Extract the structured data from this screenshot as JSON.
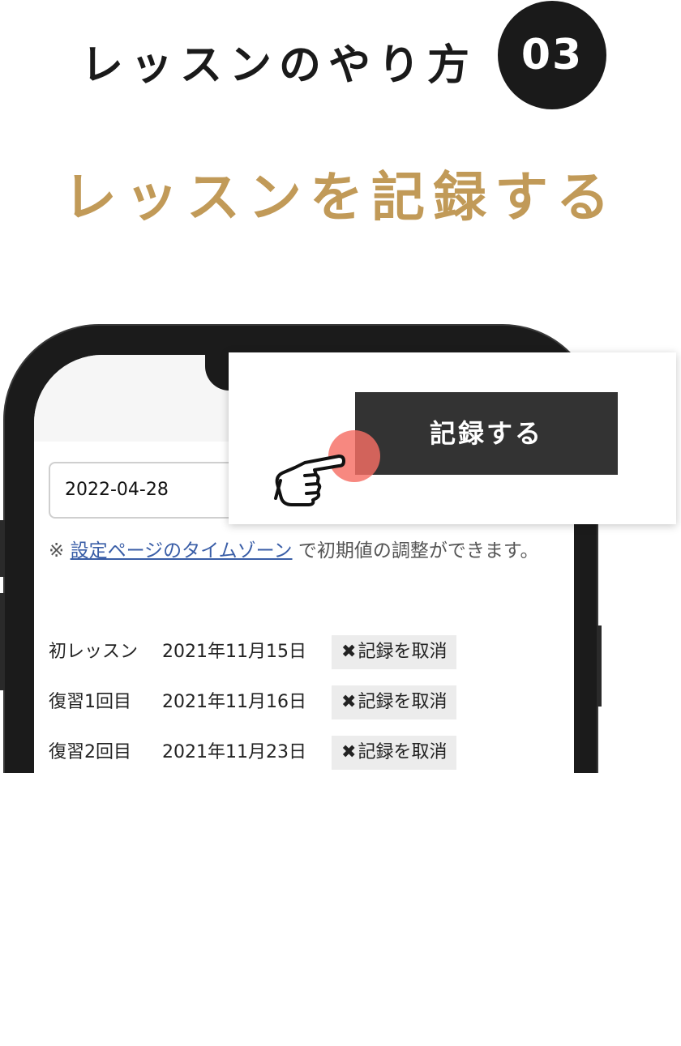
{
  "header": {
    "title": "レッスンのやり方",
    "step_number": "03"
  },
  "subtitle": "レッスンを記録する",
  "screen": {
    "date_value": "2022-04-28",
    "note": {
      "prefix": "※ ",
      "link": "設定ページのタイムゾーン",
      "suffix": " で初期値の調整ができます。"
    },
    "records": [
      {
        "label": "初レッスン",
        "date": "2021年11月15日",
        "cancel_label": "記録を取消"
      },
      {
        "label": "復習1回目",
        "date": "2021年11月16日",
        "cancel_label": "記録を取消"
      },
      {
        "label": "復習2回目",
        "date": "2021年11月23日",
        "cancel_label": "記録を取消"
      }
    ],
    "cancel_icon": "✖"
  },
  "popup": {
    "record_button_label": "記録する",
    "pointer_icon": "pointing-hand-icon"
  },
  "colors": {
    "accent_gold": "#c19a58",
    "dark": "#1a1a1a",
    "button_dark": "#333333",
    "link": "#3a5ea7",
    "tap_highlight": "#f56e64"
  }
}
